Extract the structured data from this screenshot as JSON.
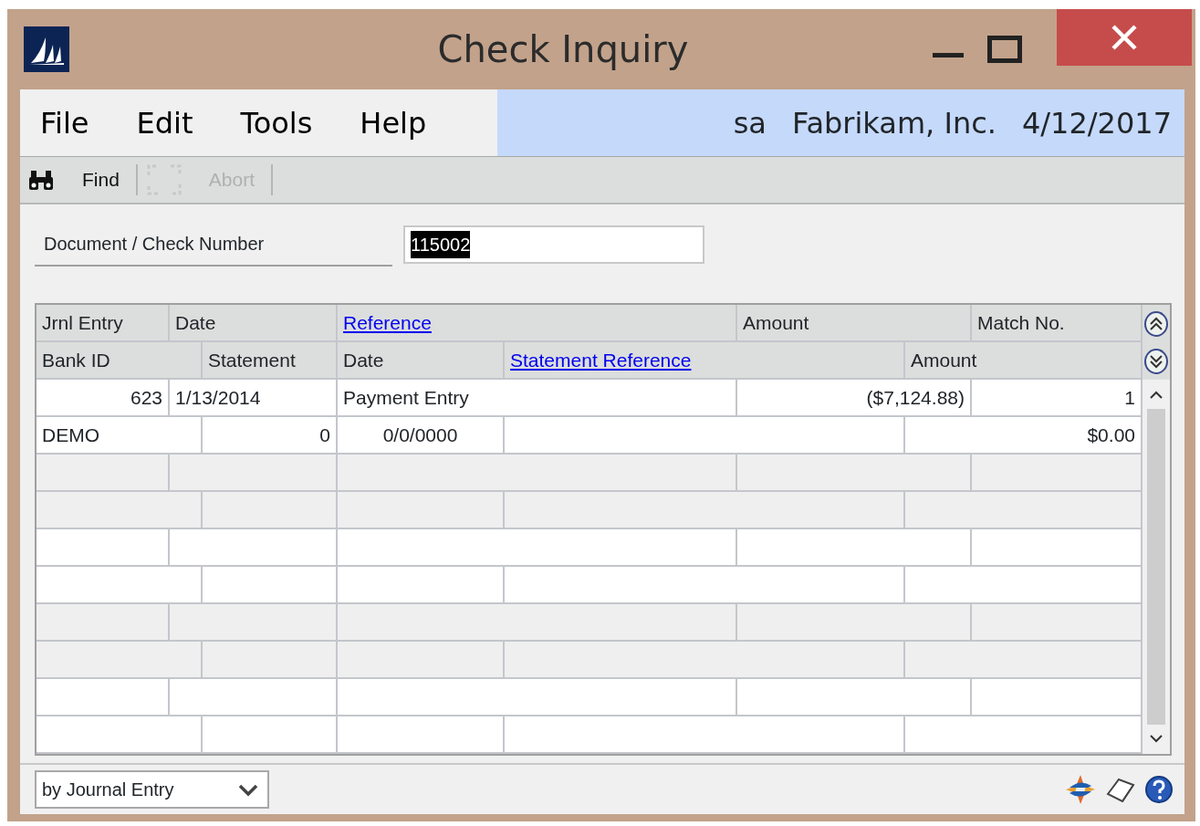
{
  "window": {
    "title": "Check Inquiry"
  },
  "menu": [
    "File",
    "Edit",
    "Tools",
    "Help"
  ],
  "session": {
    "user": "sa",
    "company": "Fabrikam, Inc.",
    "date": "4/12/2017"
  },
  "toolbar": [
    {
      "label": "Find",
      "disabled": false,
      "kind": "find"
    },
    {
      "label": "Abort",
      "disabled": true,
      "kind": "abort"
    }
  ],
  "document_field": {
    "label": "Document / Check Number",
    "value": "115002",
    "selected": true
  },
  "table": {
    "header_lines": [
      [
        {
          "label": "Jrnl Entry",
          "link": false
        },
        {
          "label": "Date",
          "link": false
        },
        {
          "label": "Reference",
          "link": true
        },
        {
          "label": "Amount",
          "link": false
        },
        {
          "label": "Match No.",
          "link": false
        }
      ],
      [
        {
          "label": "Bank ID",
          "link": false
        },
        {
          "label": "Statement",
          "link": false
        },
        {
          "label": "Date",
          "link": false
        },
        {
          "label": "Statement Reference",
          "link": true
        },
        {
          "label": "Amount",
          "link": false
        }
      ]
    ],
    "rows": [
      {
        "line_1": {
          "jrnl_entry": "623",
          "date": "1/13/2014",
          "reference": "Payment Entry",
          "amount": "($7,124.88)",
          "match_no": "1"
        },
        "line_2": {
          "bank_id": "DEMO",
          "statement": "0",
          "date": "0/0/0000",
          "amount": "$0.00"
        }
      }
    ]
  },
  "footer": {
    "sort_by": "by Journal Entry"
  }
}
